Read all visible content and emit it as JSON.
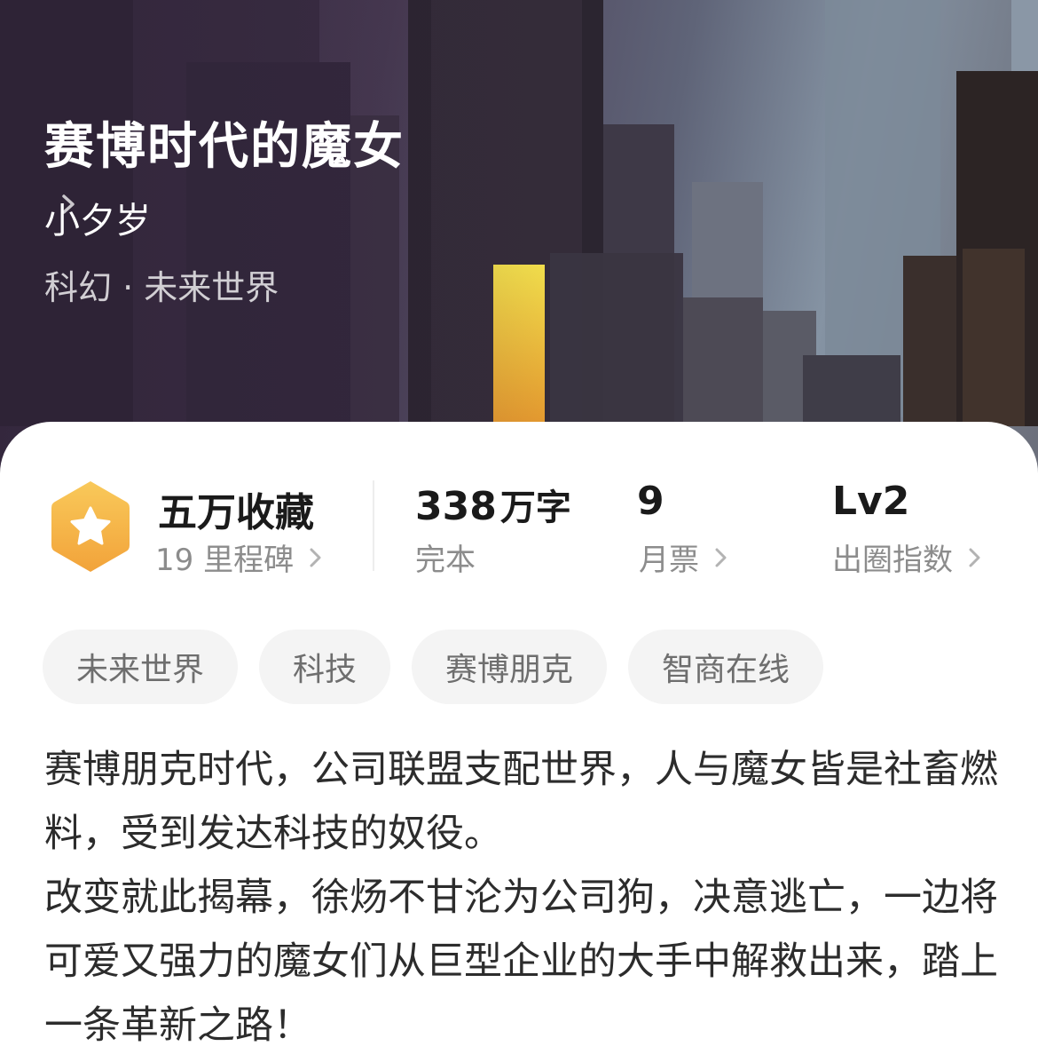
{
  "book": {
    "title": "赛博时代的魔女",
    "author": "小夕岁",
    "genre": "科幻 · 未来世界"
  },
  "stats": {
    "collection": {
      "value": "五万收藏",
      "sub": "19 里程碑"
    },
    "words": {
      "number": "338",
      "unit": "万字",
      "sub": "完本"
    },
    "monthly_ticket": {
      "value": "9",
      "sub": "月票"
    },
    "level": {
      "value": "Lv2",
      "sub": "出圈指数"
    }
  },
  "tags": [
    "未来世界",
    "科技",
    "赛博朋克",
    "智商在线"
  ],
  "synopsis": {
    "line1": "赛博朋克时代，公司联盟支配世界，人与魔女皆是社畜燃料，受到发达科技的奴役。",
    "line2": "改变就此揭幕，徐炀不甘沦为公司狗，决意逃亡，一边将可爱又强力的魔女们从巨型企业的大手中解救出来，踏上一条革新之路！"
  },
  "icons": {
    "badge": "star-hexagon-icon",
    "chevron": "chevron-right-icon"
  },
  "colors": {
    "badge_gradient_top": "#f9c95a",
    "badge_gradient_bottom": "#f2a33a",
    "glow": "#e8d046",
    "tag_bg": "#f4f4f4"
  }
}
